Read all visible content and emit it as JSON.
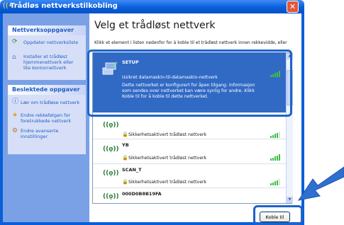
{
  "window": {
    "title": "Trådløs nettverkstilkobling",
    "close_label": "✕"
  },
  "sidebar": {
    "network_tasks": {
      "header": "Nettverksoppgaver",
      "items": [
        {
          "label": "Oppdater nettverksliste",
          "icon": "refresh-icon"
        },
        {
          "label": "Installer et trådløst hjemmenettverk eller lite kontornettverk",
          "icon": "wireless-setup-icon"
        }
      ]
    },
    "related_tasks": {
      "header": "Beslektede oppgaver",
      "items": [
        {
          "label": "Lær om trådløse nettverk",
          "icon": "info-icon"
        },
        {
          "label": "Endre rekkefølgen for foretrukkede nettverk",
          "icon": "star-icon"
        },
        {
          "label": "Endre avanserte innstillinger",
          "icon": "settings-icon"
        }
      ]
    }
  },
  "main": {
    "heading": "Velg et trådløst nettverk",
    "instruction": "Klikk et element i listen nedenfor for å koble til et trådløst nettverk innen rekkevidde, eller"
  },
  "networks": [
    {
      "name": "SETUP",
      "status": "Usikret datamaskin-til-datamaskin-nettverk",
      "description": "Dette nettverket er konfigurert for åpen tilgang. Informasjon som sendes over nettverket kan være synlig for andre. Klikk Koble til for å koble til dette nettverket.",
      "signal_bars": 5,
      "selected": true
    },
    {
      "name": "",
      "status": "Sikkerhetsaktivert trådløst nettverk",
      "signal_bars": 4
    },
    {
      "name": "YB",
      "status": "Sikkerhetsaktivert trådløst nettverk",
      "signal_bars": 5
    },
    {
      "name": "SCAN_T",
      "status": "Sikkerhetsaktivert trådløst nettverk",
      "signal_bars": 4
    },
    {
      "name": "000D0B8B19FA",
      "status": "",
      "signal_bars": 0
    }
  ],
  "buttons": {
    "connect": "Koble til"
  },
  "colors": {
    "title_blue": "#0a5fd8",
    "selection_blue": "#316ac5",
    "highlight_blue": "#1f63c8"
  }
}
